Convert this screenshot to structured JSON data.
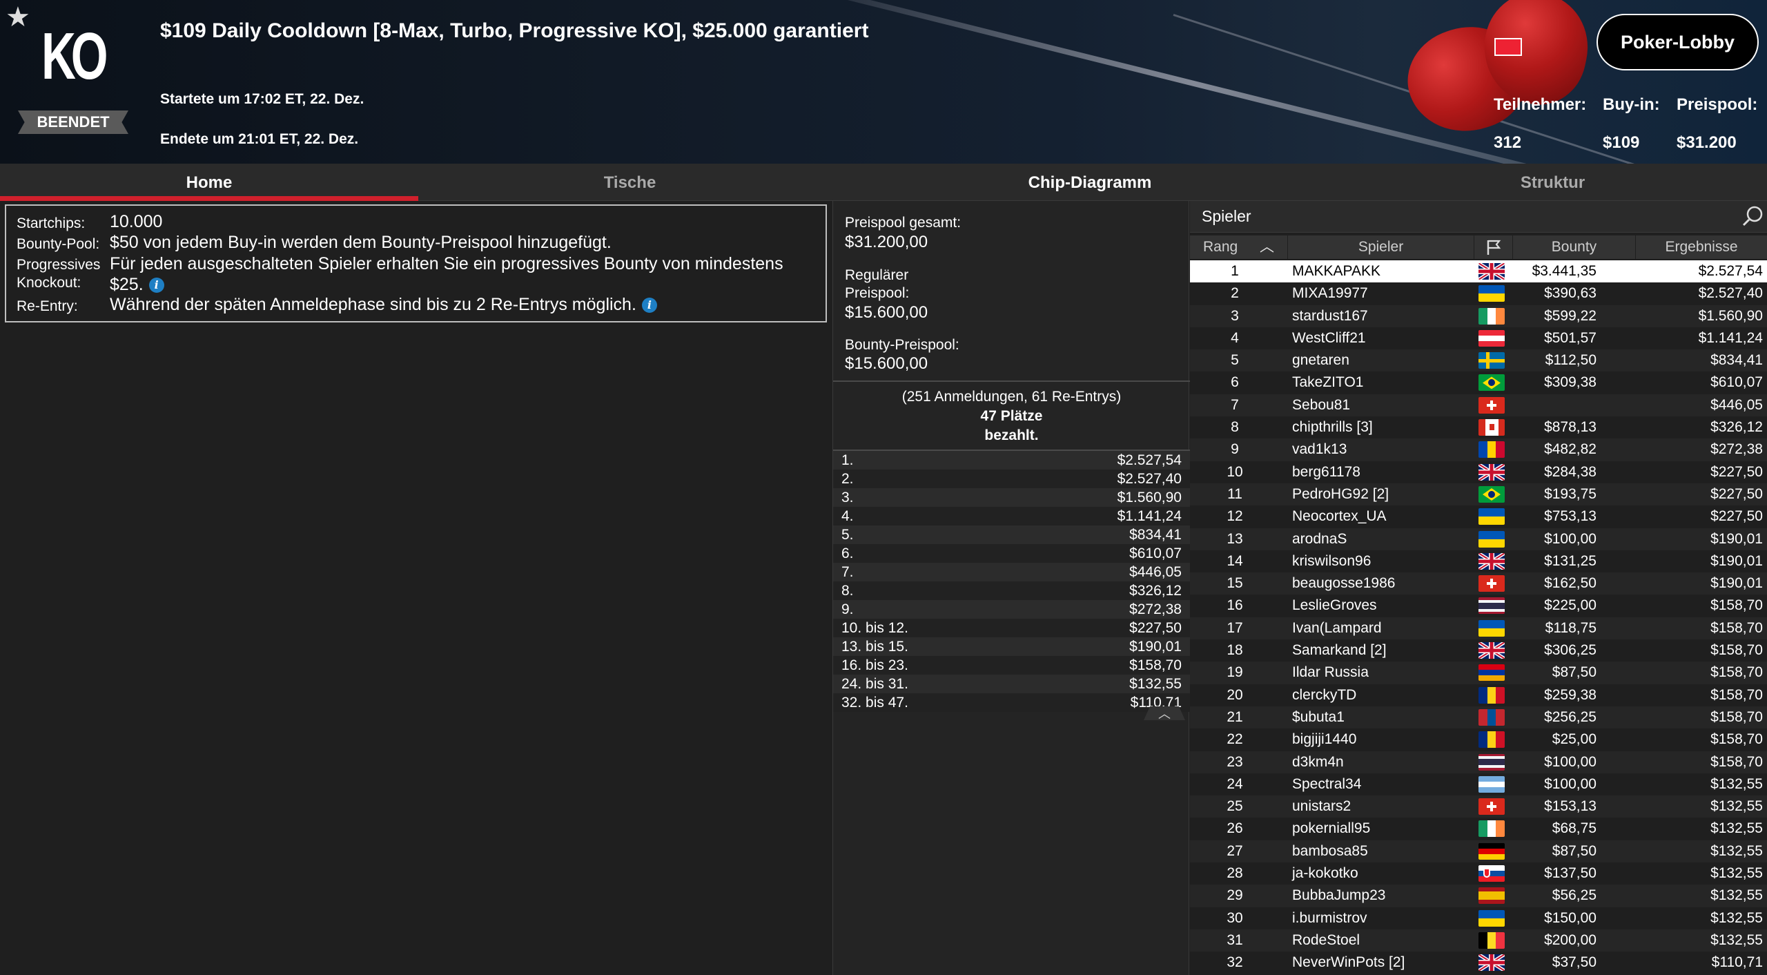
{
  "header": {
    "logo_text": "KO",
    "status": "BEENDET",
    "title": "$109 Daily Cooldown [8-Max, Turbo, Progressive KO], $25.000 garantiert",
    "start": "Startete um 17:02 ET, 22. Dez.",
    "end": "Endete um 21:01 ET, 22. Dez.",
    "lobby_button": "Poker-Lobby",
    "stats": {
      "participants_label": "Teilnehmer:",
      "participants_value": "312",
      "buyin_label": "Buy-in:",
      "buyin_value": "$109",
      "prizepool_label": "Preispool:",
      "prizepool_value": "$31.200"
    }
  },
  "tabs": [
    "Home",
    "Tische",
    "Chip-Diagramm",
    "Struktur"
  ],
  "info": {
    "startchips_label": "Startchips:",
    "startchips_value": "10.000",
    "bounty_label": "Bounty-Pool:",
    "bounty_value": "$50 von jedem Buy-in werden dem Bounty-Preispool hinzugefügt.",
    "prog_label_1": "Progressives",
    "prog_label_2": "Knockout:",
    "prog_value_1": "Für jeden ausgeschalteten Spieler erhalten Sie ein progressives Bounty von mindestens",
    "prog_value_2": "$25.",
    "reentry_label": "Re-Entry:",
    "reentry_value": "Während der späten Anmeldephase sind bis zu 2 Re-Entrys möglich."
  },
  "prize": {
    "total_label": "Preispool gesamt:",
    "total_value": "$31.200,00",
    "regular_label_1": "Regulärer",
    "regular_label_2": "Preispool:",
    "regular_value": "$15.600,00",
    "bounty_label": "Bounty-Preispool:",
    "bounty_value": "$15.600,00",
    "entries_text": "(251 Anmeldungen, 61 Re-Entrys)",
    "places_text": "47 Plätze",
    "paid_text": "bezahlt.",
    "payouts": [
      {
        "place": "1.",
        "amount": "$2.527,54"
      },
      {
        "place": "2.",
        "amount": "$2.527,40"
      },
      {
        "place": "3.",
        "amount": "$1.560,90"
      },
      {
        "place": "4.",
        "amount": "$1.141,24"
      },
      {
        "place": "5.",
        "amount": "$834,41"
      },
      {
        "place": "6.",
        "amount": "$610,07"
      },
      {
        "place": "7.",
        "amount": "$446,05"
      },
      {
        "place": "8.",
        "amount": "$326,12"
      },
      {
        "place": "9.",
        "amount": "$272,38"
      },
      {
        "place": "10. bis 12.",
        "amount": "$227,50"
      },
      {
        "place": "13. bis 15.",
        "amount": "$190,01"
      },
      {
        "place": "16. bis 23.",
        "amount": "$158,70"
      },
      {
        "place": "24. bis 31.",
        "amount": "$132,55"
      },
      {
        "place": "32. bis 47.",
        "amount": "$110,71"
      }
    ]
  },
  "players": {
    "search_label": "Spieler",
    "columns": [
      "Rang",
      "Spieler",
      "Bounty",
      "Ergebnisse"
    ],
    "rows": [
      {
        "rank": "1",
        "name": "MAKKAPAKK",
        "flag": "gb",
        "bounty": "$3.441,35",
        "result": "$2.527,54"
      },
      {
        "rank": "2",
        "name": "MIXA19977",
        "flag": "ua",
        "bounty": "$390,63",
        "result": "$2.527,40"
      },
      {
        "rank": "3",
        "name": "stardust167",
        "flag": "ie",
        "bounty": "$599,22",
        "result": "$1.560,90"
      },
      {
        "rank": "4",
        "name": "WestCliff21",
        "flag": "at",
        "bounty": "$501,57",
        "result": "$1.141,24"
      },
      {
        "rank": "5",
        "name": "gnetaren",
        "flag": "se",
        "bounty": "$112,50",
        "result": "$834,41"
      },
      {
        "rank": "6",
        "name": "TakeZITO1",
        "flag": "br",
        "bounty": "$309,38",
        "result": "$610,07"
      },
      {
        "rank": "7",
        "name": "Sebou81",
        "flag": "ch",
        "bounty": "",
        "result": "$446,05"
      },
      {
        "rank": "8",
        "name": "chipthrills [3]",
        "flag": "ca",
        "bounty": "$878,13",
        "result": "$326,12"
      },
      {
        "rank": "9",
        "name": "vad1k13",
        "flag": "md",
        "bounty": "$482,82",
        "result": "$272,38"
      },
      {
        "rank": "10",
        "name": "berg61178",
        "flag": "gb",
        "bounty": "$284,38",
        "result": "$227,50"
      },
      {
        "rank": "11",
        "name": "PedroHG92 [2]",
        "flag": "br",
        "bounty": "$193,75",
        "result": "$227,50"
      },
      {
        "rank": "12",
        "name": "Neocortex_UA",
        "flag": "ua",
        "bounty": "$753,13",
        "result": "$227,50"
      },
      {
        "rank": "13",
        "name": "arodnaS",
        "flag": "ua",
        "bounty": "$100,00",
        "result": "$190,01"
      },
      {
        "rank": "14",
        "name": "kriswilson96",
        "flag": "gb",
        "bounty": "$131,25",
        "result": "$190,01"
      },
      {
        "rank": "15",
        "name": "beaugosse1986",
        "flag": "ch",
        "bounty": "$162,50",
        "result": "$190,01"
      },
      {
        "rank": "16",
        "name": "LeslieGroves",
        "flag": "th",
        "bounty": "$225,00",
        "result": "$158,70"
      },
      {
        "rank": "17",
        "name": "Ivan(Lampard",
        "flag": "ua",
        "bounty": "$118,75",
        "result": "$158,70"
      },
      {
        "rank": "18",
        "name": "Samarkand [2]",
        "flag": "gb",
        "bounty": "$306,25",
        "result": "$158,70"
      },
      {
        "rank": "19",
        "name": "Ildar Russia",
        "flag": "am",
        "bounty": "$87,50",
        "result": "$158,70"
      },
      {
        "rank": "20",
        "name": "clerckyTD",
        "flag": "ro",
        "bounty": "$259,38",
        "result": "$158,70"
      },
      {
        "rank": "21",
        "name": "$ubuta1",
        "flag": "mn",
        "bounty": "$256,25",
        "result": "$158,70"
      },
      {
        "rank": "22",
        "name": "bigjiji1440",
        "flag": "ro",
        "bounty": "$25,00",
        "result": "$158,70"
      },
      {
        "rank": "23",
        "name": "d3km4n",
        "flag": "th",
        "bounty": "$100,00",
        "result": "$158,70"
      },
      {
        "rank": "24",
        "name": "Spectral34",
        "flag": "ar",
        "bounty": "$100,00",
        "result": "$132,55"
      },
      {
        "rank": "25",
        "name": "unistars2",
        "flag": "ch",
        "bounty": "$153,13",
        "result": "$132,55"
      },
      {
        "rank": "26",
        "name": "pokerniall95",
        "flag": "ie",
        "bounty": "$68,75",
        "result": "$132,55"
      },
      {
        "rank": "27",
        "name": "bambosa85",
        "flag": "de",
        "bounty": "$87,50",
        "result": "$132,55"
      },
      {
        "rank": "28",
        "name": "ja-kokotko",
        "flag": "sk",
        "bounty": "$137,50",
        "result": "$132,55"
      },
      {
        "rank": "29",
        "name": "BubbaJump23",
        "flag": "es",
        "bounty": "$56,25",
        "result": "$132,55"
      },
      {
        "rank": "30",
        "name": "i.burmistrov",
        "flag": "ua",
        "bounty": "$150,00",
        "result": "$132,55"
      },
      {
        "rank": "31",
        "name": "RodeStoel",
        "flag": "be",
        "bounty": "$200,00",
        "result": "$132,55"
      },
      {
        "rank": "32",
        "name": "NeverWinPots [2]",
        "flag": "gb",
        "bounty": "$37,50",
        "result": "$110,71"
      }
    ]
  },
  "colors": {
    "accent_red": "#d0202c",
    "info_blue": "#1e7fc4",
    "background": "#1f1f1f"
  }
}
